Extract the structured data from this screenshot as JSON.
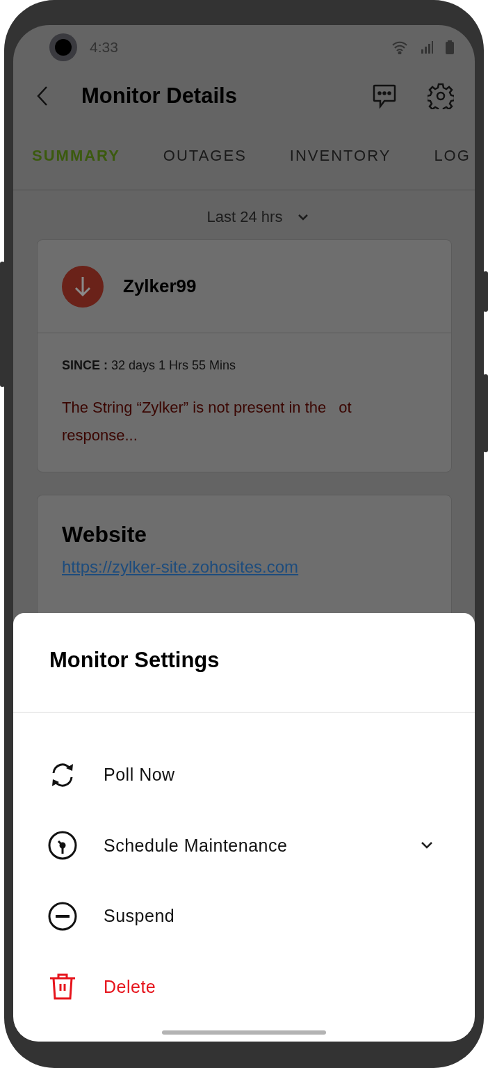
{
  "status_bar": {
    "time": "4:33"
  },
  "header": {
    "title": "Monitor Details"
  },
  "tabs": [
    {
      "label": "SUMMARY",
      "selected": true
    },
    {
      "label": "OUTAGES",
      "selected": false
    },
    {
      "label": "INVENTORY",
      "selected": false
    },
    {
      "label": "LOG",
      "selected": false
    }
  ],
  "period": {
    "value": "Last 24 hrs"
  },
  "monitor_card": {
    "name": "Zylker99",
    "down": true,
    "since_label": "SINCE :",
    "since_value": "32 days 1 Hrs 55 Mins",
    "message_line_1": "The String “Zylker” is not present in the",
    "message_fragment": "ot",
    "message_line_2": "response..."
  },
  "website_card": {
    "title": "Website",
    "url": "https://zylker-site.zohosites.com"
  },
  "sheet": {
    "title": "Monitor Settings",
    "items": [
      {
        "kind": "poll",
        "label": "Poll Now",
        "destructive": false,
        "expandable": false
      },
      {
        "kind": "schedule",
        "label": "Schedule Maintenance",
        "destructive": false,
        "expandable": true
      },
      {
        "kind": "suspend",
        "label": "Suspend",
        "destructive": false,
        "expandable": false
      },
      {
        "kind": "delete",
        "label": "Delete",
        "destructive": true,
        "expandable": false
      }
    ]
  }
}
